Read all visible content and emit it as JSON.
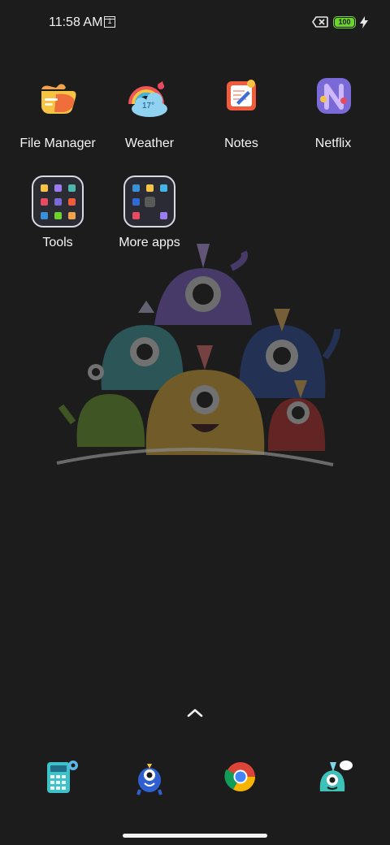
{
  "status": {
    "time": "11:58 AM",
    "calendar_day": "1",
    "battery_percent": "100",
    "charging": true,
    "sim_status": "no-sim-icon",
    "battery_color": "#6cd32b"
  },
  "home": {
    "apps": [
      {
        "label": "File Manager",
        "icon": "file-manager-icon"
      },
      {
        "label": "Weather",
        "icon": "weather-icon",
        "temp": "17°"
      },
      {
        "label": "Notes",
        "icon": "notes-icon"
      },
      {
        "label": "Netflix",
        "icon": "netflix-icon"
      }
    ],
    "folders": [
      {
        "label": "Tools",
        "icon": "folder-icon"
      },
      {
        "label": "More apps",
        "icon": "folder-icon"
      }
    ]
  },
  "dock": {
    "items": [
      {
        "icon": "calculator-icon"
      },
      {
        "icon": "monster-app-icon"
      },
      {
        "icon": "chrome-icon"
      },
      {
        "icon": "messaging-monster-icon"
      }
    ]
  },
  "colors": {
    "background": "#1c1c1c",
    "text": "#f4f4f4"
  }
}
